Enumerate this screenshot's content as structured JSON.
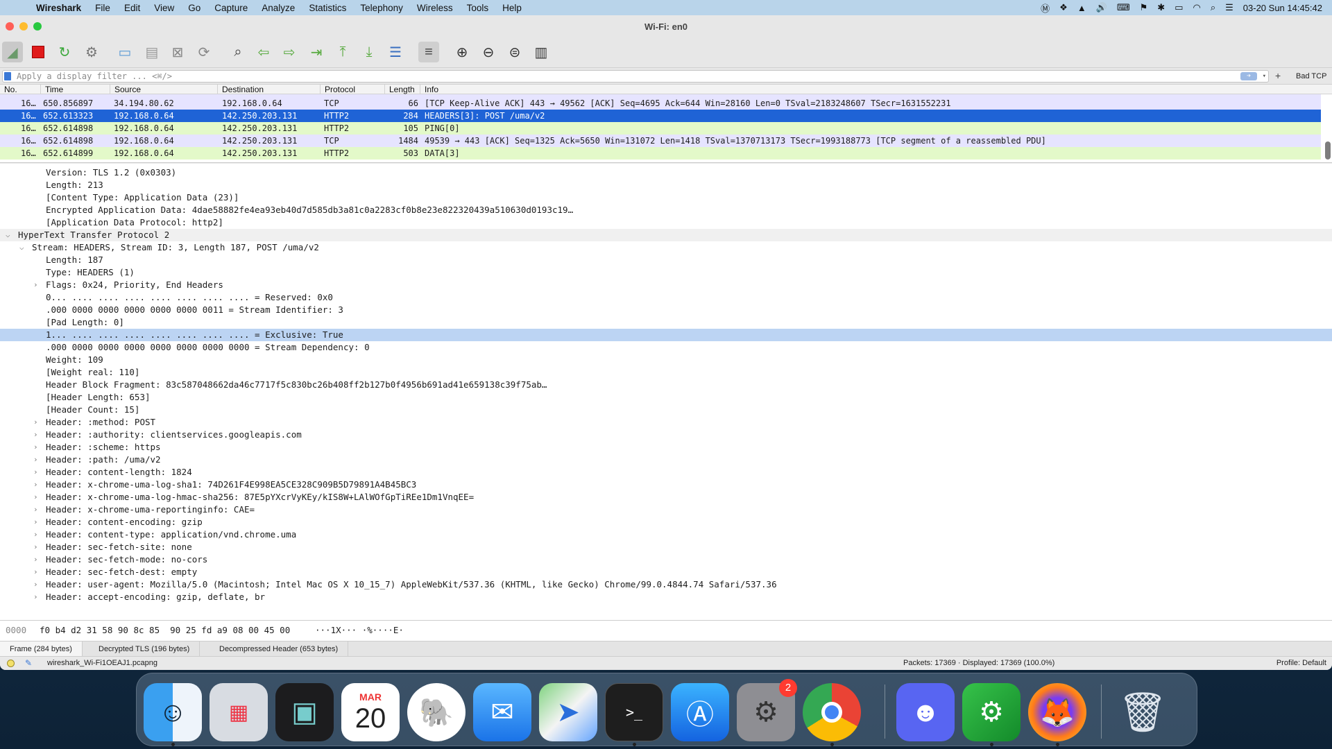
{
  "menubar": {
    "items": [
      "Wireshark",
      "File",
      "Edit",
      "View",
      "Go",
      "Capture",
      "Analyze",
      "Statistics",
      "Telephony",
      "Wireless",
      "Tools",
      "Help"
    ],
    "clock": "03-20 Sun  14:45:42"
  },
  "window": {
    "title": "Wi-Fi: en0"
  },
  "filter": {
    "placeholder": "Apply a display filter ... <⌘/>",
    "bad_tcp": "Bad TCP",
    "add": "+"
  },
  "packet_list": {
    "columns": [
      "No.",
      "Time",
      "Source",
      "Destination",
      "Protocol",
      "Length",
      "Info"
    ],
    "rows": [
      {
        "no": "16…",
        "time": "650.856897",
        "src": "34.194.80.62",
        "dst": "192.168.0.64",
        "proto": "TCP",
        "len": "66",
        "info": "[TCP Keep-Alive ACK] 443 → 49562 [ACK] Seq=4695 Ack=644 Win=28160 Len=0 TSval=2183248607 TSecr=1631552231",
        "style": "lav"
      },
      {
        "no": "16…",
        "time": "652.613323",
        "src": "192.168.0.64",
        "dst": "142.250.203.131",
        "proto": "HTTP2",
        "len": "284",
        "info": "HEADERS[3]: POST /uma/v2",
        "style": "sel"
      },
      {
        "no": "16…",
        "time": "652.614898",
        "src": "192.168.0.64",
        "dst": "142.250.203.131",
        "proto": "HTTP2",
        "len": "105",
        "info": "PING[0]",
        "style": "green"
      },
      {
        "no": "16…",
        "time": "652.614898",
        "src": "192.168.0.64",
        "dst": "142.250.203.131",
        "proto": "TCP",
        "len": "1484",
        "info": "49539 → 443 [ACK] Seq=1325 Ack=5650 Win=131072 Len=1418 TSval=1370713173 TSecr=1993188773 [TCP segment of a reassembled PDU]",
        "style": "lav"
      },
      {
        "no": "16…",
        "time": "652.614899",
        "src": "192.168.0.64",
        "dst": "142.250.203.131",
        "proto": "HTTP2",
        "len": "503",
        "info": "DATA[3]",
        "style": "green"
      }
    ]
  },
  "details": {
    "lines": [
      {
        "text": "Version: TLS 1.2 (0x0303)",
        "indent": 3
      },
      {
        "text": "Length: 213",
        "indent": 3
      },
      {
        "text": "[Content Type: Application Data (23)]",
        "indent": 3
      },
      {
        "text": "Encrypted Application Data: 4dae58882fe4ea93eb40d7d585db3a81c0a2283cf0b8e23e822320439a510630d0193c19…",
        "indent": 3
      },
      {
        "text": "[Application Data Protocol: http2]",
        "indent": 3
      },
      {
        "text": "HyperText Transfer Protocol 2",
        "indent": 1,
        "chev": "open",
        "section": true
      },
      {
        "text": "Stream: HEADERS, Stream ID: 3, Length 187, POST /uma/v2",
        "indent": 2,
        "chev": "open"
      },
      {
        "text": "Length: 187",
        "indent": 3
      },
      {
        "text": "Type: HEADERS (1)",
        "indent": 3
      },
      {
        "text": "Flags: 0x24, Priority, End Headers",
        "indent": 3,
        "chev": "closed"
      },
      {
        "text": "0... .... .... .... .... .... .... .... = Reserved: 0x0",
        "indent": 3
      },
      {
        "text": ".000 0000 0000 0000 0000 0000 0011 = Stream Identifier: 3",
        "indent": 3
      },
      {
        "text": "[Pad Length: 0]",
        "indent": 3
      },
      {
        "text": "1... .... .... .... .... .... .... .... = Exclusive: True",
        "indent": 3,
        "selected": true
      },
      {
        "text": ".000 0000 0000 0000 0000 0000 0000 0000 = Stream Dependency: 0",
        "indent": 3
      },
      {
        "text": "Weight: 109",
        "indent": 3
      },
      {
        "text": "[Weight real: 110]",
        "indent": 3
      },
      {
        "text": "Header Block Fragment: 83c587048662da46c7717f5c830bc26b408ff2b127b0f4956b691ad41e659138c39f75ab…",
        "indent": 3
      },
      {
        "text": "[Header Length: 653]",
        "indent": 3
      },
      {
        "text": "[Header Count: 15]",
        "indent": 3
      },
      {
        "text": "Header: :method: POST",
        "indent": 3,
        "chev": "closed"
      },
      {
        "text": "Header: :authority: clientservices.googleapis.com",
        "indent": 3,
        "chev": "closed"
      },
      {
        "text": "Header: :scheme: https",
        "indent": 3,
        "chev": "closed"
      },
      {
        "text": "Header: :path: /uma/v2",
        "indent": 3,
        "chev": "closed"
      },
      {
        "text": "Header: content-length: 1824",
        "indent": 3,
        "chev": "closed"
      },
      {
        "text": "Header: x-chrome-uma-log-sha1: 74D261F4E998EA5CE328C909B5D79891A4B45BC3",
        "indent": 3,
        "chev": "closed"
      },
      {
        "text": "Header: x-chrome-uma-log-hmac-sha256: 87E5pYXcrVyKEy/kIS8W+LAlWOfGpTiREe1Dm1VnqEE=",
        "indent": 3,
        "chev": "closed"
      },
      {
        "text": "Header: x-chrome-uma-reportinginfo: CAE=",
        "indent": 3,
        "chev": "closed"
      },
      {
        "text": "Header: content-encoding: gzip",
        "indent": 3,
        "chev": "closed"
      },
      {
        "text": "Header: content-type: application/vnd.chrome.uma",
        "indent": 3,
        "chev": "closed"
      },
      {
        "text": "Header: sec-fetch-site: none",
        "indent": 3,
        "chev": "closed"
      },
      {
        "text": "Header: sec-fetch-mode: no-cors",
        "indent": 3,
        "chev": "closed"
      },
      {
        "text": "Header: sec-fetch-dest: empty",
        "indent": 3,
        "chev": "closed"
      },
      {
        "text": "Header: user-agent: Mozilla/5.0 (Macintosh; Intel Mac OS X 10_15_7) AppleWebKit/537.36 (KHTML, like Gecko) Chrome/99.0.4844.74 Safari/537.36",
        "indent": 3,
        "chev": "closed"
      },
      {
        "text": "Header: accept-encoding: gzip, deflate, br",
        "indent": 3,
        "chev": "closed"
      }
    ]
  },
  "bytes": {
    "offset": "0000",
    "hex": "f0 b4 d2 31 58 90 8c 85  90 25 fd a9 08 00 45 00",
    "ascii": "···1X··· ·%····E·"
  },
  "tabs": [
    "Frame (284 bytes)",
    "Decrypted TLS (196 bytes)",
    "Decompressed Header (653 bytes)"
  ],
  "status": {
    "file": "wireshark_Wi-Fi1OEAJ1.pcapng",
    "packets": "Packets: 17369 · Displayed: 17369 (100.0%)",
    "profile": "Profile: Default"
  },
  "dock": {
    "calendar_month": "MAR",
    "calendar_day": "20",
    "settings_badge": "2"
  },
  "colors": {
    "selected": "#1f63d6",
    "detail_selected": "#bcd4f3",
    "green": "#e3f9c9",
    "lavender": "#e6e4ff",
    "accent": "#1f63d6"
  }
}
